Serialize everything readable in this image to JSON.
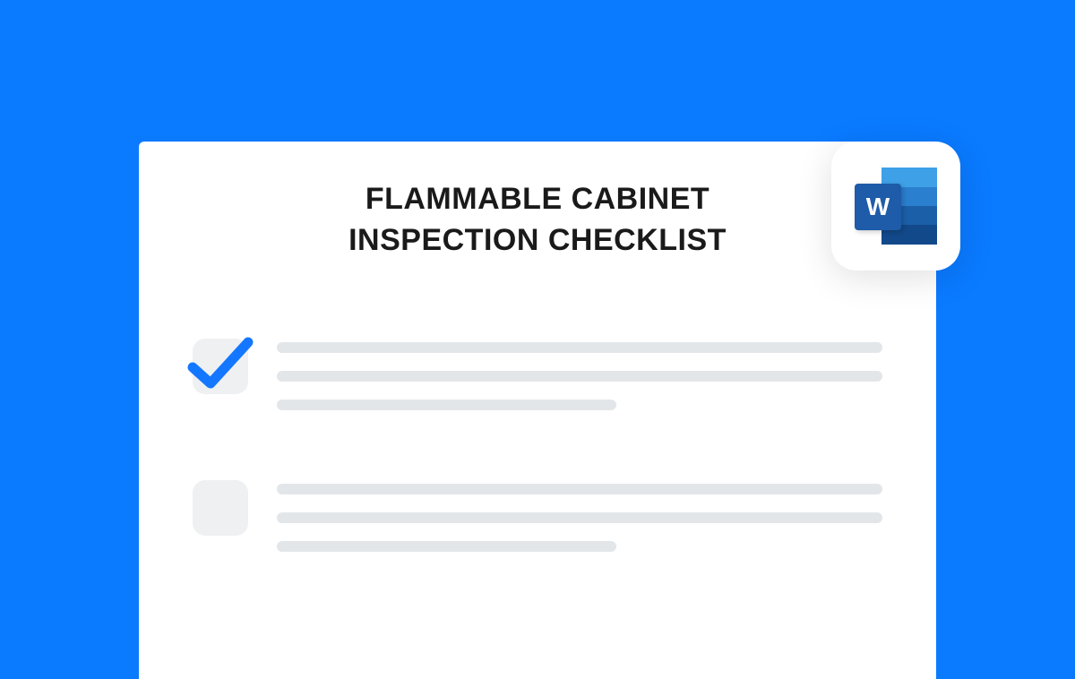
{
  "document": {
    "title": "FLAMMABLE CABINET INSPECTION CHECKLIST"
  },
  "badge": {
    "app": "Microsoft Word",
    "letter": "W"
  },
  "checklist": {
    "items": [
      {
        "checked": true,
        "line_widths": [
          "w1",
          "w2",
          "w3"
        ]
      },
      {
        "checked": false,
        "line_widths": [
          "w1",
          "w2",
          "w3"
        ]
      }
    ]
  },
  "colors": {
    "background": "#0a7aff",
    "accent": "#1477ff",
    "placeholder": "#e3e6e9"
  }
}
